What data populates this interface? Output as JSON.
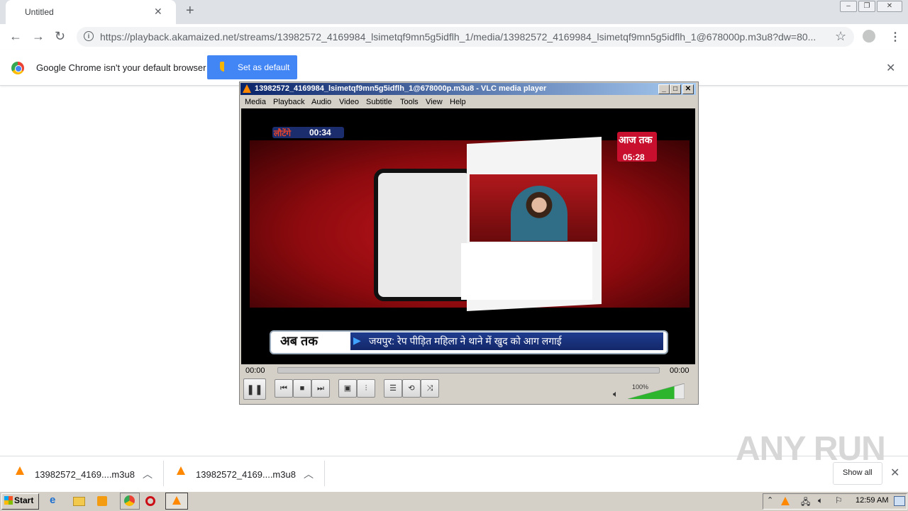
{
  "browser": {
    "tab_title": "Untitled",
    "tab_close": "✕",
    "new_tab": "+",
    "url": "https://playback.akamaized.net/streams/13982572_4169984_lsimetqf9mn5g5idflh_1/media/13982572_4169984_lsimetqf9mn5g5idflh_1@678000p.m3u8?dw=80...",
    "infobar_text": "Google Chrome isn't your default browser",
    "set_default_label": "Set as default",
    "infobar_close": "✕"
  },
  "vlc": {
    "title": "13982572_4169984_lsimetqf9mn5g5idflh_1@678000p.m3u8 - VLC media player",
    "menu": [
      "Media",
      "Playback",
      "Audio",
      "Video",
      "Subtitle",
      "Tools",
      "View",
      "Help"
    ],
    "time_elapsed": "00:00",
    "time_total": "00:00",
    "volume_label": "100%",
    "volume_level": 1.0,
    "video": {
      "countdown_prefix": "लौटेंगे",
      "countdown_time": "00:34",
      "channel_logo": "आज तक",
      "channel_time": "05:28",
      "ticker_label": "अब तक",
      "ticker_text": "जयपुर: रेप पीड़ित महिला ने थाने में खुद को आग लगाई"
    }
  },
  "downloads": {
    "items": [
      {
        "name": "13982572_4169....m3u8"
      },
      {
        "name": "13982572_4169....m3u8"
      }
    ],
    "show_all": "Show all",
    "close": "✕"
  },
  "watermark": "ANY RUN",
  "taskbar": {
    "start": "Start",
    "clock": "12:59 AM"
  }
}
